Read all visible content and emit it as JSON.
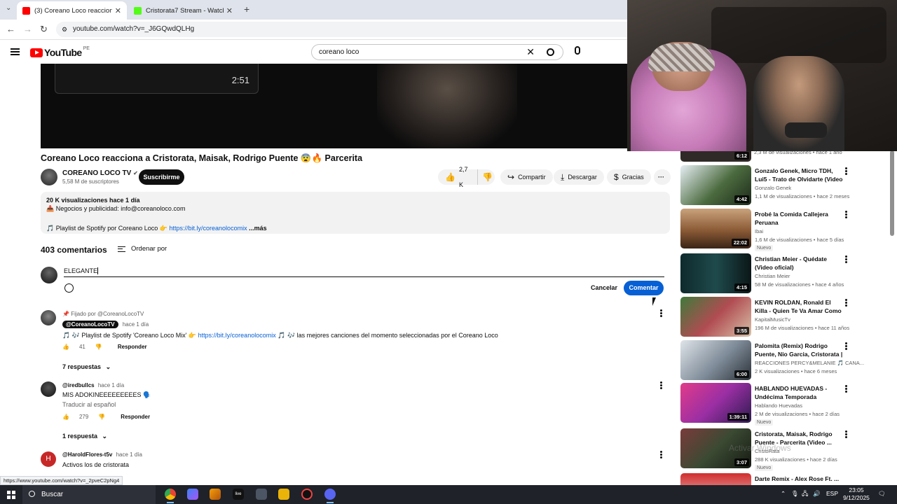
{
  "browser": {
    "tabs": [
      {
        "title": "(3) Coreano Loco reacciona a C",
        "color": "#ff0000"
      },
      {
        "title": "Cristorata7 Stream - Watch Live",
        "color": "#53fc18"
      }
    ],
    "url": "youtube.com/watch?v=_J6GQwdQLHg",
    "status_url": "https://www.youtube.com/watch?v=_2pveC2pNg4"
  },
  "masthead": {
    "logo": "YouTube",
    "country": "PE",
    "search_value": "coreano loco"
  },
  "player": {
    "endcard_time": "2:51"
  },
  "video": {
    "title": "Coreano Loco reacciona a Cristorata, Maisak, Rodrigo Puente 😨🔥 Parcerita",
    "channel": "COREANO LOCO TV",
    "subscribers": "5,58 M de suscriptores",
    "subscribe_label": "Suscribirme",
    "likes": "2,7 K",
    "share_label": "Compartir",
    "download_label": "Descargar",
    "thanks_label": "Gracias",
    "desc": {
      "stats": "20 K visualizaciones  hace 1 día",
      "line2": "📥 Negocios y publicidad: info@coreanoloco.com",
      "line3_prefix": "🎵 Playlist de Spotify por Coreano Loco 👉",
      "line3_link": "https://bit.ly/coreanolocomix",
      "more": "...más"
    }
  },
  "comments": {
    "count": "403 comentarios",
    "sort_label": "Ordenar por",
    "input_value": "ELEGANTE",
    "cancel_label": "Cancelar",
    "submit_label": "Comentar",
    "items": [
      {
        "pinned": "Fijado por @CoreanoLocoTV",
        "author": "@CoreanoLocoTV",
        "time": "hace 1 día",
        "text_prefix": "🎵 🎶 Playlist de Spotify 'Coreano Loco Mix' 👉",
        "link": "https://bit.ly/coreanolocomix",
        "text_suffix": "🎵 🎶 las mejores canciones del momento seleccionadas por el Coreano Loco",
        "likes": "41",
        "reply": "Responder",
        "replies": "7 respuestas"
      },
      {
        "author": "@iredbullcs",
        "time": "hace 1 día",
        "text": "MIS ADOKINEEEEEEEEES 🗣️",
        "translate": "Traducir al español",
        "likes": "279",
        "reply": "Responder",
        "replies": "1 respuesta"
      },
      {
        "author": "@HaroldFlores-t5v",
        "time": "hace 1 día",
        "text": "Activos los de cristorata",
        "initial": "H"
      }
    ]
  },
  "sidebar": {
    "partial_top": "2,3 M de visualizaciones • hace 1 año",
    "partial_duration": "6:12",
    "items": [
      {
        "title": "Gonzalo Genek, Micro TDH, Lui5 - Trato de Olvidarte (Video ...",
        "channel": "Gonzalo Genek",
        "meta": "1,1 M de visualizaciones • hace 2 meses",
        "duration": "4:42",
        "badge": "",
        "thumb": "#4c6b3f"
      },
      {
        "title": "Probé la Comida Callejera Peruana",
        "channel": "Ibai",
        "meta": "1,6 M de visualizaciones • hace 5 días",
        "duration": "22:02",
        "badge": "Nuevo",
        "thumb": "#8a5a35"
      },
      {
        "title": "Christian Meier - Quédate (Video oficial)",
        "channel": "Christian Meier",
        "meta": "58 M de visualizaciones • hace 4 años",
        "duration": "4:15",
        "badge": "",
        "thumb": "#1f4a4c"
      },
      {
        "title": "KEVIN ROLDAN, Ronald El Killa - Quien Te Va Amar Como Yo ...",
        "channel": "KapitalMusicTv",
        "meta": "196 M de visualizaciones • hace 11 años",
        "duration": "3:55",
        "badge": "",
        "thumb": "#b04c52"
      },
      {
        "title": "Palomita (Remix) Rodrigo Puente, Nio Garcia, Cristorata | ...",
        "channel": "REACCIONES PERCY&MELANIE 🎵 CANA...",
        "meta": "2 K visualizaciones • hace 6 meses",
        "duration": "6:00",
        "badge": "",
        "thumb": "#7d8a97"
      },
      {
        "title": "HABLANDO HUEVADAS - Undécima Temporada [SEÑOR...",
        "channel": "Hablando Huevadas",
        "meta": "2 M de visualizaciones • hace 2 días",
        "duration": "1:39:11",
        "badge": "Nuevo",
        "thumb": "#9a2fa4"
      },
      {
        "title": "Cristorata, Maisak, Rodrigo Puente - Parcerita (Video ...",
        "channel": "CristoRata",
        "meta": "288 K visualizaciones • hace 2 días",
        "duration": "3:07",
        "badge": "Nuevo",
        "thumb": "#3b4a33"
      },
      {
        "title": "Darte Remix - Alex Rose Ft. ...",
        "channel": "",
        "meta": "",
        "duration": "",
        "badge": "",
        "thumb": "#d12d2d"
      }
    ]
  },
  "taskbar": {
    "search_label": "Buscar",
    "lang": "ESP",
    "time": "23:05",
    "date": "9/12/2025"
  },
  "watermark": "Activar Windows"
}
